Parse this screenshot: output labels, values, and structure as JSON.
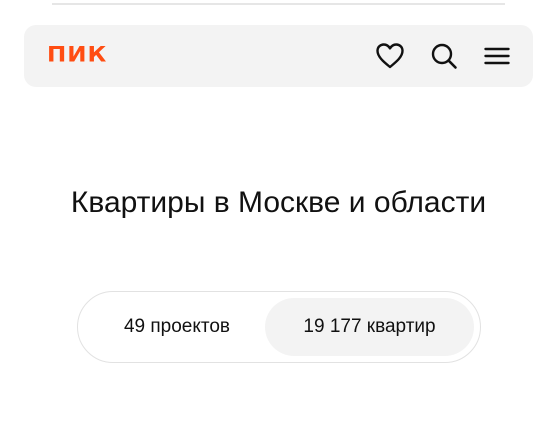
{
  "header": {
    "logo_text": "ПИК",
    "icons": [
      "heart-icon",
      "search-icon",
      "menu-icon"
    ]
  },
  "main": {
    "title": "Квартиры в Москве и области",
    "tabs": [
      {
        "label": "49 проектов",
        "selected": false
      },
      {
        "label": "19 177 квартир",
        "selected": true
      }
    ]
  },
  "colors": {
    "brand": "#ff4d12",
    "header_bg": "#f3f3f3",
    "text": "#111111",
    "selected_tab_bg": "#f3f3f3",
    "border": "#e2e2e2"
  }
}
